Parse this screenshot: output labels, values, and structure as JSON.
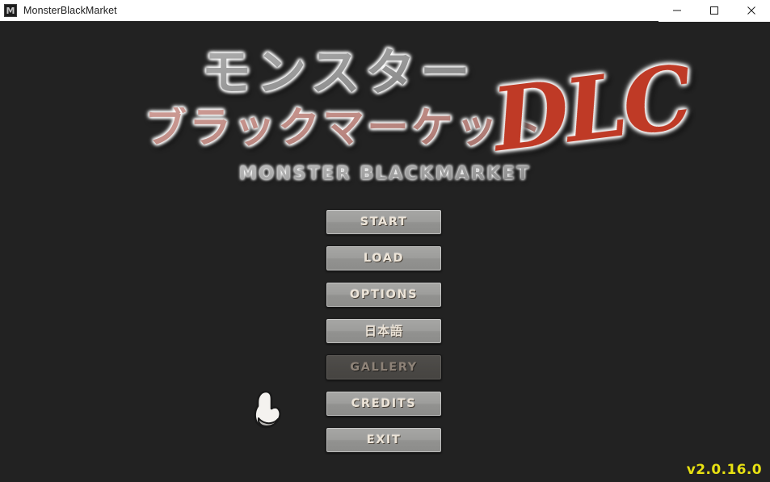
{
  "window": {
    "title": "MonsterBlackMarket",
    "icon": "app-icon",
    "icon_glyph": "M",
    "controls": {
      "minimize_label": "minimize-icon",
      "maximize_label": "maximize-icon",
      "close_label": "close-icon"
    },
    "titlebar_bg": "#ffffff",
    "titlebar_text_color": "#1c1c1c"
  },
  "game": {
    "background_color": "#222222",
    "logo": {
      "kana_line1": "モンスター",
      "kana_line2": "ブラックマーケット",
      "dlc_badge": "DLC",
      "subtitle": "MONSTER BLACKMARKET",
      "kana1_color": "#a8a8a8",
      "kana2_color": "#c39089",
      "dlc_color": "#bf3a26",
      "outline_color": "#ffffff"
    },
    "menu": {
      "buttons": [
        {
          "label": "START",
          "name": "start-button",
          "enabled": true
        },
        {
          "label": "LOAD",
          "name": "load-button",
          "enabled": true
        },
        {
          "label": "OPTIONS",
          "name": "options-button",
          "enabled": true
        },
        {
          "label": "日本語",
          "name": "language-button",
          "enabled": true
        },
        {
          "label": "GALLERY",
          "name": "gallery-button",
          "enabled": false
        },
        {
          "label": "CREDITS",
          "name": "credits-button",
          "enabled": true
        },
        {
          "label": "EXIT",
          "name": "exit-button",
          "enabled": true
        }
      ],
      "button_face_color": "#9d9d9b",
      "button_text_color": "#ece4d8",
      "disabled_face_color": "#4a4845",
      "disabled_text_color": "#8e8378"
    },
    "cursor": {
      "name": "pointing-hand-cursor",
      "fill": "#f4f2ef",
      "outline": "#1a1a1a"
    },
    "version": {
      "text": "v2.0.16.0",
      "color": "#e8e112"
    }
  }
}
